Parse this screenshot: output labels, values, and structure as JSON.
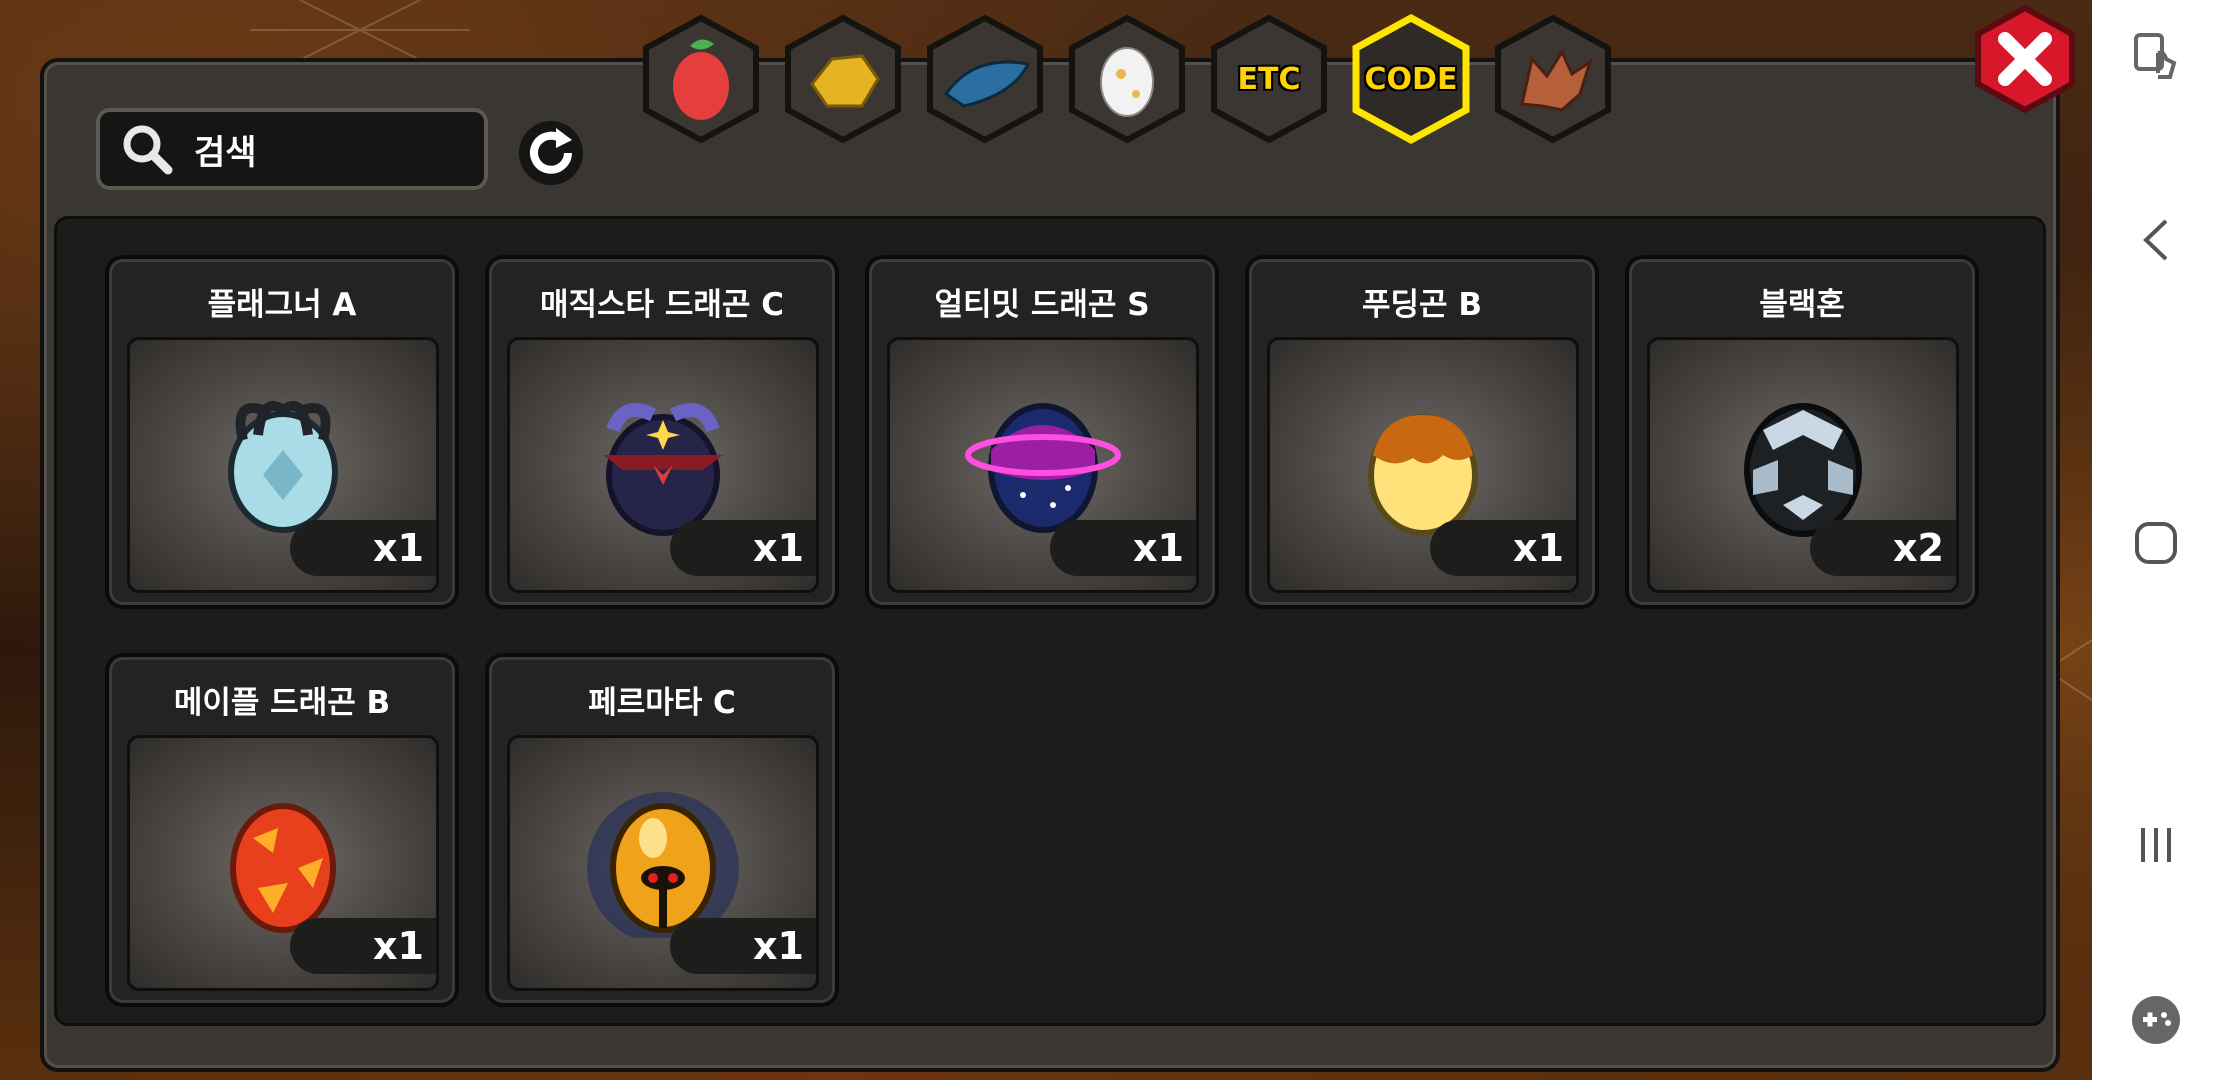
{
  "search": {
    "placeholder": "검색"
  },
  "tabs": [
    {
      "name": "fruit-tab-icon",
      "label": ""
    },
    {
      "name": "gold-ore-tab-icon",
      "label": ""
    },
    {
      "name": "blue-feather-tab-icon",
      "label": ""
    },
    {
      "name": "egg-tab-icon",
      "label": ""
    },
    {
      "name": "etc-tab",
      "label": "ETC"
    },
    {
      "name": "code-tab",
      "label": "CODE",
      "selected": true
    },
    {
      "name": "dragon-tab-icon",
      "label": ""
    }
  ],
  "items": [
    {
      "name": "플래그너 A",
      "qty": "x1"
    },
    {
      "name": "매직스타 드래곤 C",
      "qty": "x1"
    },
    {
      "name": "얼티밋 드래곤 S",
      "qty": "x1"
    },
    {
      "name": "푸딩곤 B",
      "qty": "x1"
    },
    {
      "name": "블랙혼",
      "qty": "x2"
    },
    {
      "name": "메이플 드래곤 B",
      "qty": "x1"
    },
    {
      "name": "페르마타 C",
      "qty": "x1"
    }
  ],
  "colors": {
    "selected_tab_border": "#ffe600",
    "close_button": "#d8182a",
    "tab_label": "#ffd400"
  }
}
